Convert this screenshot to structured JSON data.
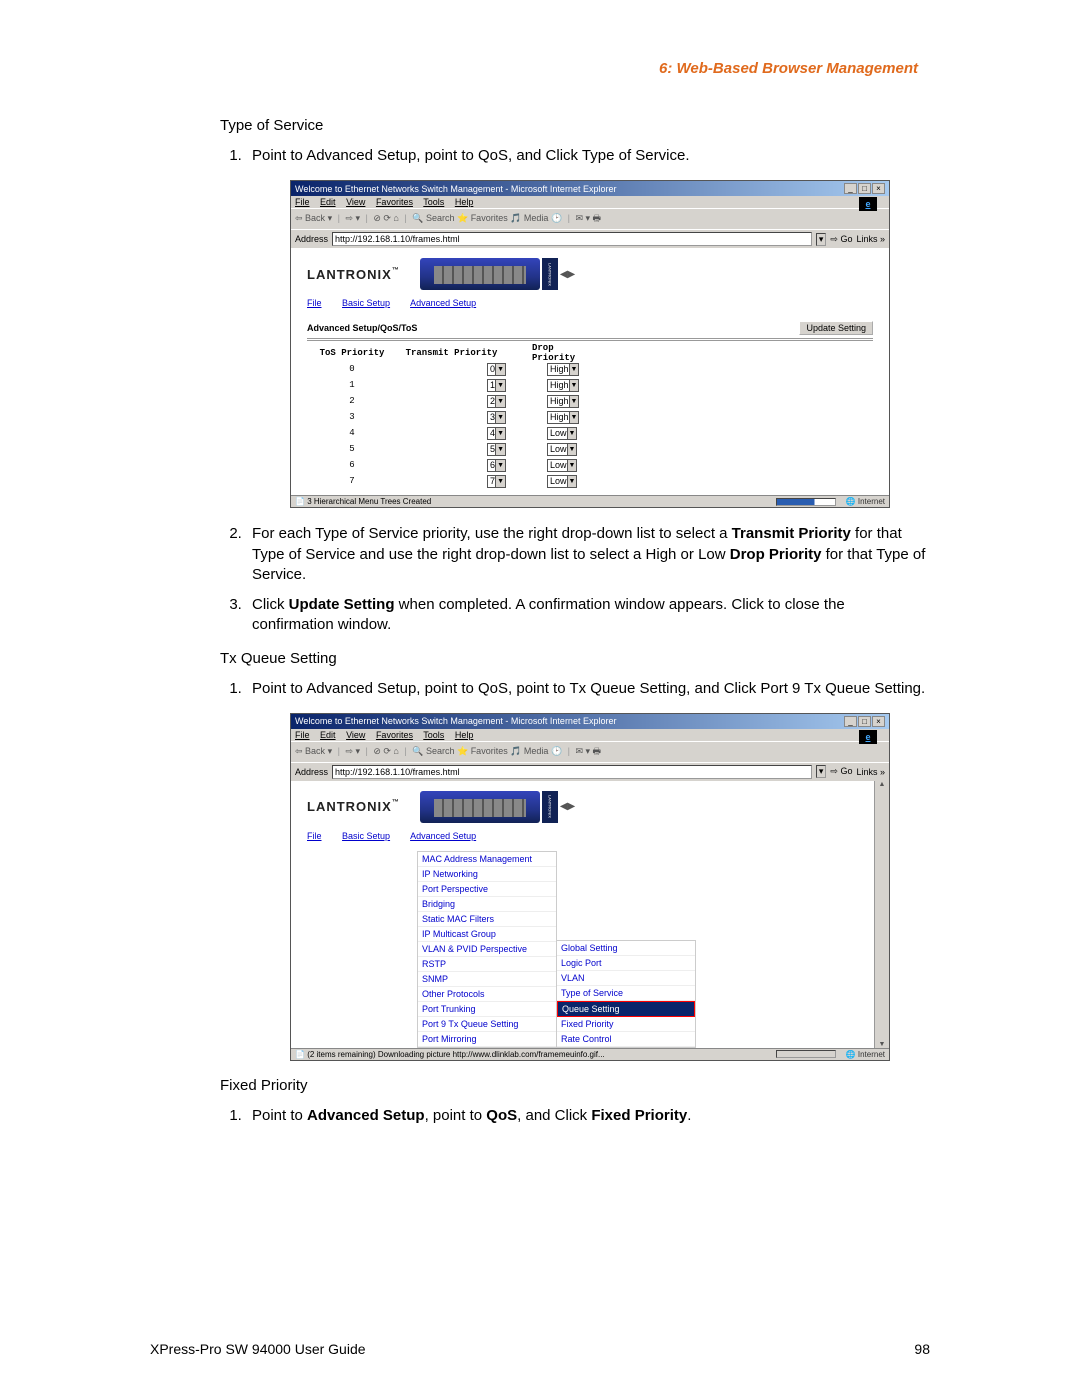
{
  "header": "6: Web-Based Browser Management",
  "s1_title": "Type of Service",
  "s1_step1": "Point to Advanced Setup, point to QoS, and Click Type of Service.",
  "ie": {
    "title": "Welcome to Ethernet Networks Switch Management - Microsoft Internet Explorer",
    "menu": {
      "file": "File",
      "edit": "Edit",
      "view": "View",
      "fav": "Favorites",
      "tools": "Tools",
      "help": "Help"
    },
    "toolbar": {
      "back": "Back",
      "search": "Search",
      "favorites": "Favorites",
      "media": "Media"
    },
    "addr_label": "Address",
    "addr_value": "http://192.168.1.10/frames.html",
    "go": "Go",
    "links": "Links",
    "brand": "LANTRONIX",
    "badge": "LANTRONIX",
    "nav_file": "File",
    "nav_basic": "Basic Setup",
    "nav_adv": "Advanced Setup",
    "internet": "Internet"
  },
  "shot1": {
    "bc": "Advanced Setup/QoS/ToS",
    "update": "Update Setting",
    "headers": {
      "c1": "ToS Priority",
      "c2": "Transmit Priority",
      "c3": "Drop Priority"
    },
    "rows": [
      {
        "p": "0",
        "t": "0",
        "d": "High"
      },
      {
        "p": "1",
        "t": "1",
        "d": "High"
      },
      {
        "p": "2",
        "t": "2",
        "d": "High"
      },
      {
        "p": "3",
        "t": "3",
        "d": "High"
      },
      {
        "p": "4",
        "t": "4",
        "d": "Low"
      },
      {
        "p": "5",
        "t": "5",
        "d": "Low"
      },
      {
        "p": "6",
        "t": "6",
        "d": "Low"
      },
      {
        "p": "7",
        "t": "7",
        "d": "Low"
      }
    ],
    "status": "3 Hierarchical Menu Trees Created"
  },
  "s1_step2a": "For each Type of Service priority, use the right drop-down list to select a ",
  "s1_step2b": "Transmit Priority",
  "s1_step2c": " for that Type of Service and use the right drop-down list to select a High or Low ",
  "s1_step2d": "Drop Priority",
  "s1_step2e": " for that Type of Service.",
  "s1_step3a": "Click ",
  "s1_step3b": "Update Setting",
  "s1_step3c": " when completed. A confirmation window appears. Click to close the confirmation window.",
  "s2_title": "Tx Queue Setting",
  "s2_step1": "Point to Advanced Setup, point to QoS, point to Tx Queue Setting, and Click Port 9 Tx Queue Setting.",
  "shot2": {
    "menu1": [
      "MAC Address Management",
      "IP Networking",
      "Port Perspective",
      "Bridging",
      "Static MAC Filters",
      "IP Multicast Group",
      "VLAN & PVID Perspective",
      "RSTP",
      "SNMP",
      "Other Protocols",
      "Port Trunking",
      "Port 9 Tx Queue Setting",
      "Port Mirroring"
    ],
    "menu2": [
      "Global Setting",
      "Logic Port",
      "VLAN",
      "Type of Service",
      "Queue Setting",
      "Fixed Priority",
      "Rate Control"
    ],
    "menu2_hi_index": 4,
    "status": "(2 items remaining) Downloading picture http://www.dlinklab.com/framemeuinfo.gif..."
  },
  "s3_title": "Fixed Priority",
  "s3_step1a": "Point to ",
  "s3_step1b": "Advanced Setup",
  "s3_step1c": ", point to ",
  "s3_step1d": "QoS",
  "s3_step1e": ", and Click ",
  "s3_step1f": "Fixed Priority",
  "s3_step1g": ".",
  "footer_left": "XPress-Pro SW 94000 User Guide",
  "footer_right": "98"
}
